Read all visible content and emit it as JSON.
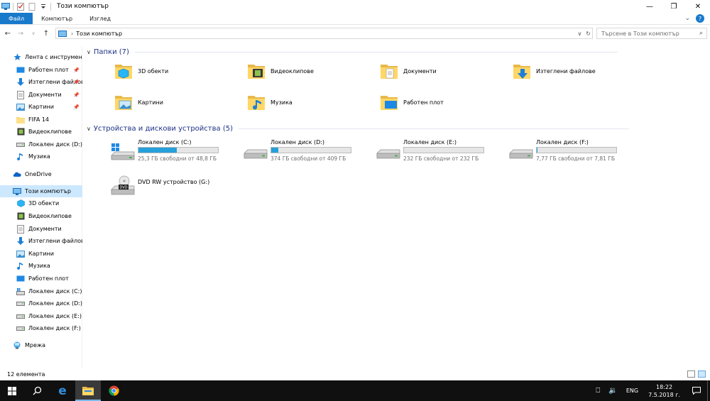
{
  "window": {
    "title": "Този компютър",
    "controls": [
      "minimize",
      "maximize",
      "close"
    ]
  },
  "ribbon": {
    "tabs": [
      "Файл",
      "Компютър",
      "Изглед"
    ]
  },
  "address": {
    "path": "Този компютър",
    "search_placeholder": "Търсене в Този компютър"
  },
  "sidebar": {
    "quick_access": "Лента с инструменти",
    "items": [
      {
        "label": "Работен плот",
        "icon": "desktop-icon",
        "pinned": true
      },
      {
        "label": "Изтеглени файлове",
        "icon": "download-icon",
        "pinned": true
      },
      {
        "label": "Документи",
        "icon": "documents-icon",
        "pinned": true
      },
      {
        "label": "Картини",
        "icon": "pictures-icon",
        "pinned": true
      },
      {
        "label": "FIFA 14",
        "icon": "folder-icon",
        "pinned": false
      },
      {
        "label": "Видеоклипове",
        "icon": "videos-icon",
        "pinned": false
      },
      {
        "label": "Локален диск (D:)",
        "icon": "drive-icon",
        "pinned": false
      },
      {
        "label": "Музика",
        "icon": "music-icon",
        "pinned": false
      }
    ],
    "onedrive": "OneDrive",
    "this_pc": "Този компютър",
    "pc_items": [
      {
        "label": "3D обекти",
        "icon": "3d-objects-icon"
      },
      {
        "label": "Видеоклипове",
        "icon": "videos-icon"
      },
      {
        "label": "Документи",
        "icon": "documents-icon"
      },
      {
        "label": "Изтеглени файлове",
        "icon": "download-icon"
      },
      {
        "label": "Картини",
        "icon": "pictures-icon"
      },
      {
        "label": "Музика",
        "icon": "music-icon"
      },
      {
        "label": "Работен плот",
        "icon": "desktop-icon"
      },
      {
        "label": "Локален диск (C:)",
        "icon": "windows-drive-icon"
      },
      {
        "label": "Локален диск (D:)",
        "icon": "drive-icon"
      },
      {
        "label": "Локален диск (E:)",
        "icon": "drive-icon"
      },
      {
        "label": "Локален диск (F:)",
        "icon": "drive-icon"
      }
    ],
    "network": "Мрежа"
  },
  "folders_group": {
    "title": "Папки (7)",
    "items": [
      {
        "label": "3D обекти",
        "icon": "3d-objects-folder-icon"
      },
      {
        "label": "Видеоклипове",
        "icon": "videos-folder-icon"
      },
      {
        "label": "Документи",
        "icon": "documents-folder-icon"
      },
      {
        "label": "Изтеглени файлове",
        "icon": "downloads-folder-icon"
      },
      {
        "label": "Картини",
        "icon": "pictures-folder-icon"
      },
      {
        "label": "Музика",
        "icon": "music-folder-icon"
      },
      {
        "label": "Работен плот",
        "icon": "desktop-folder-icon"
      }
    ]
  },
  "drives_group": {
    "title": "Устройства и дискови устройства (5)",
    "items": [
      {
        "label": "Локален диск (C:)",
        "free": "25,3 ГБ свободни от 48,8 ГБ",
        "used_fraction": 0.48,
        "icon": "windows-drive-icon"
      },
      {
        "label": "Локален диск (D:)",
        "free": "374 ГБ свободни от 409 ГБ",
        "used_fraction": 0.09,
        "icon": "drive-icon"
      },
      {
        "label": "Локален диск (E:)",
        "free": "232 ГБ свободни от 232 ГБ",
        "used_fraction": 0.0,
        "icon": "drive-icon"
      },
      {
        "label": "Локален диск (F:)",
        "free": "7,77 ГБ свободни от 7,81 ГБ",
        "used_fraction": 0.005,
        "icon": "drive-icon"
      }
    ],
    "dvd": {
      "label": "DVD RW устройство (G:)",
      "icon": "dvd-drive-icon"
    }
  },
  "status": {
    "count": "12 елемента"
  },
  "taskbar": {
    "language": "ENG",
    "time": "18:22",
    "date": "7.5.2018 г."
  },
  "colors": {
    "accent": "#1979ca",
    "progress": "#26a0da",
    "group_header": "#1e3287",
    "taskbar": "#101010"
  }
}
